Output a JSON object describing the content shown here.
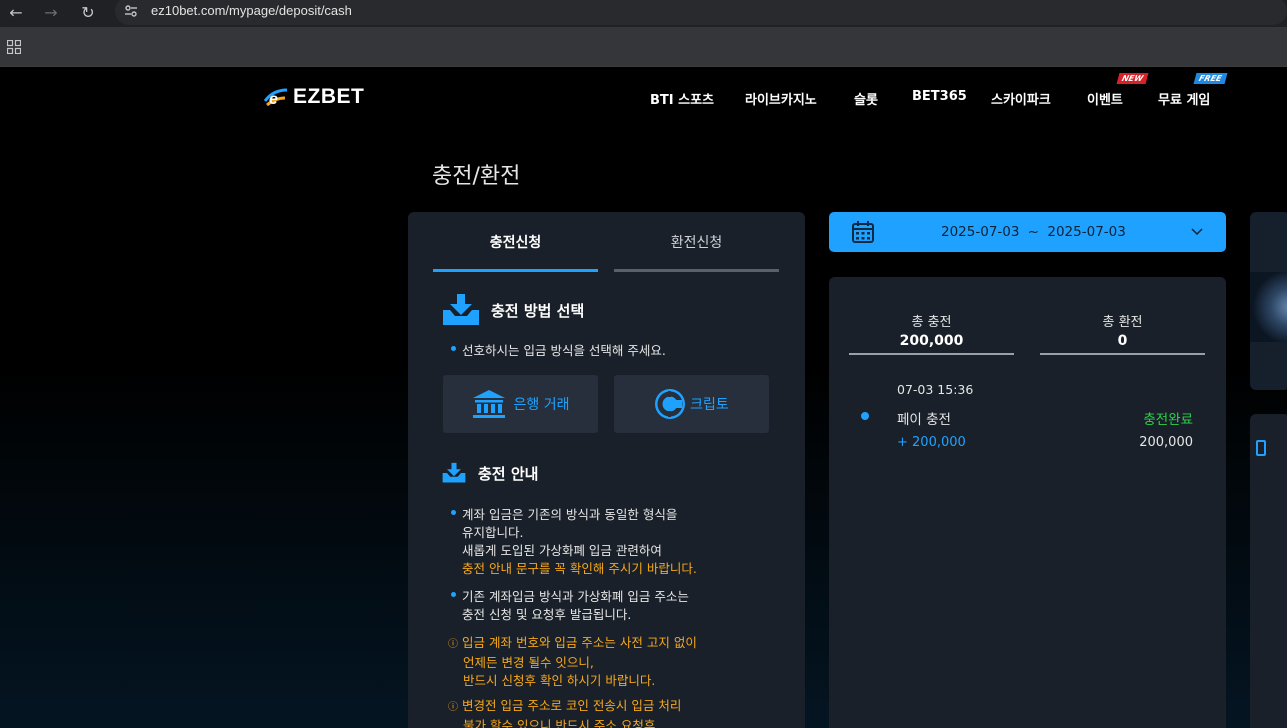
{
  "browser": {
    "url": "ez10bet.com/mypage/deposit/cash"
  },
  "header": {
    "logo_text": "EZBET",
    "nav": [
      {
        "label": "BTI 스포츠"
      },
      {
        "label": "라이브카지노"
      },
      {
        "label": "슬롯"
      },
      {
        "label": "BET365"
      },
      {
        "label": "스카이파크"
      },
      {
        "label": "이벤트",
        "badge": "NEW",
        "badge_color": "#d6232a"
      },
      {
        "label": "무료 게임",
        "badge": "FREE",
        "badge_color": "#1e88e5"
      }
    ]
  },
  "page": {
    "title": "충전/환전"
  },
  "tabs": {
    "deposit": "충전신청",
    "withdraw": "환전신청"
  },
  "method_section": {
    "title": "충전 방법 선택",
    "hint": "선호하시는 입금 방식을 선택해 주세요.",
    "bank_label": "은행 거래",
    "crypto_label": "크립토"
  },
  "guide_section": {
    "title": "충전 안내",
    "item1_line1": "계좌 입금은 기존의 방식과 동일한 형식을",
    "item1_line2": "유지합니다.",
    "item1_line3": "새롭게 도입된 가상화폐 입금 관련하여",
    "item1_line4": "충전 안내 문구를 꼭 확인해 주시기 바랍니다.",
    "item2_line1": "기존 계좌입금 방식과 가상화폐 입금 주소는",
    "item2_line2": "충전 신청 및 요청후 발급됩니다.",
    "warn1_line1": "입금 계좌 번호와 입금 주소는 사전 고지 없이",
    "warn1_line2": "언제든 변경 될수 잇으니,",
    "warn1_line3": "반드시 신청후 확인 하시기 바랍니다.",
    "warn2_line1": "변경전 입금 주소로 코인 전송시 입금 처리",
    "warn2_line2": "불가 할수 있으니 반드시 주소 요청후"
  },
  "date_filter": {
    "start": "2025-07-03",
    "separator": "~",
    "end": "2025-07-03"
  },
  "summary": {
    "total_deposit_label": "총 충전",
    "total_deposit_value": "200,000",
    "total_withdraw_label": "총 환전",
    "total_withdraw_value": "0"
  },
  "transactions": [
    {
      "time": "07-03 15:36",
      "type": "페이 충전",
      "status": "충전완료",
      "amount": "+ 200,000",
      "balance": "200,000"
    }
  ],
  "colors": {
    "accent": "#1fa2ff",
    "panel": "#1a2029",
    "warning": "#f6a81b",
    "success": "#2fd14b"
  }
}
